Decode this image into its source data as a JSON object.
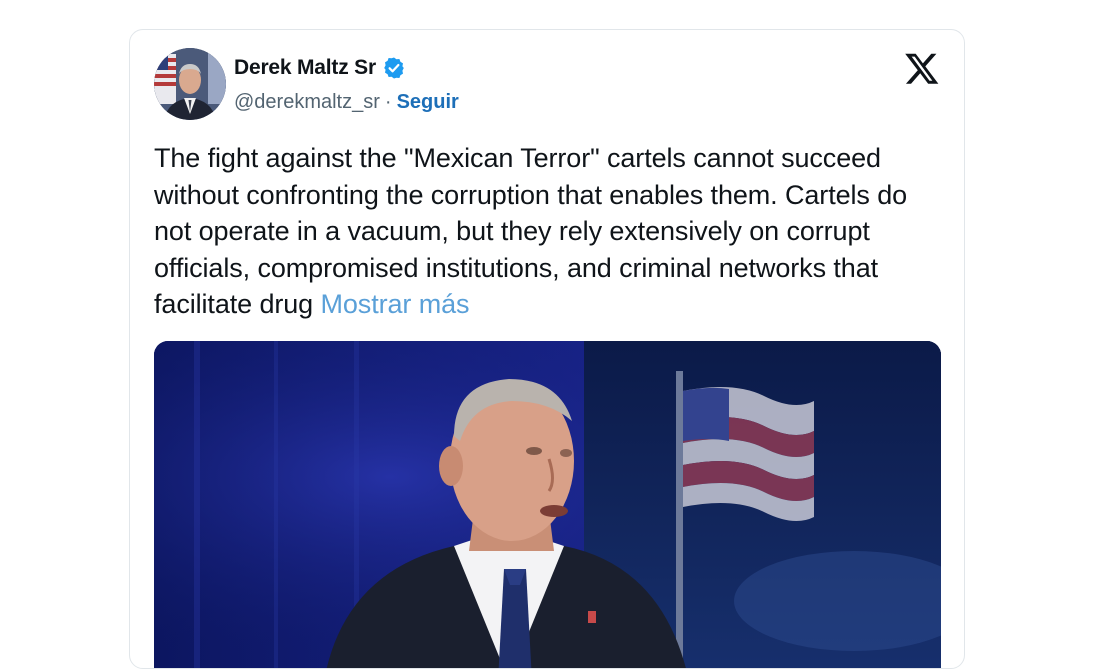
{
  "author": {
    "name": "Derek Maltz Sr",
    "handle": "@derekmaltz_sr",
    "separator": "·",
    "follow_label": "Seguir",
    "avatar_icon": "profile-photo",
    "verified_icon": "verified-badge-icon",
    "verified_color": "#1d9bf0"
  },
  "platform": {
    "logo_icon": "x-logo-icon"
  },
  "tweet": {
    "text": "The fight against the \"Mexican Terror\" cartels cannot succeed without confronting the corruption that enables them. Cartels do not operate in a vacuum, but they rely extensively on corrupt officials, compromised institutions, and criminal networks that facilitate drug",
    "show_more_label": "Mostrar más"
  },
  "media": {
    "type": "video-still",
    "icon": "video-thumbnail"
  },
  "colors": {
    "link": "#1d6fb8",
    "show_more": "#5aa0d8",
    "text": "#0f1419",
    "muted": "#536471"
  }
}
